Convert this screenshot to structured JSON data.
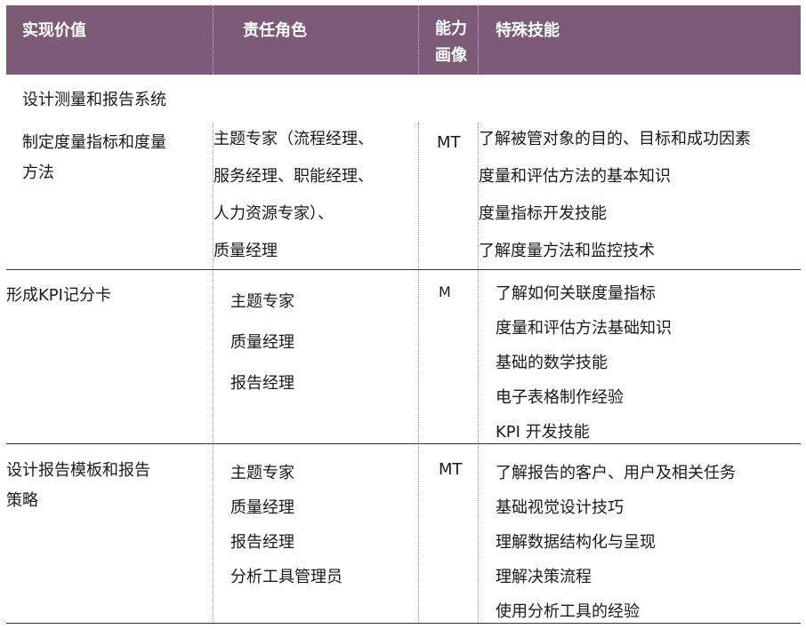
{
  "header": {
    "col1": "实现价值",
    "col2": "责任角色",
    "col3_line1": "能力",
    "col3_line2": "画像",
    "col4": "特殊技能"
  },
  "section_title": "设计测量和报告系统",
  "rows": [
    {
      "value_line1": "制定度量指标和度量",
      "value_line2": "方法",
      "roles": [
        "主题专家（流程经理、",
        "服务经理、职能经理、",
        "人力资源专家）、",
        "质量经理"
      ],
      "profile": "MT",
      "skills": [
        "了解被管对象的目的、目标和成功因素",
        "度量和评估方法的基本知识",
        "度量指标开发技能",
        "了解度量方法和监控技术"
      ]
    },
    {
      "value_line1": "形成KPI记分卡",
      "roles": [
        "主题专家",
        "质量经理",
        "报告经理"
      ],
      "profile": "M",
      "skills": [
        "了解如何关联度量指标",
        "度量和评估方法基础知识",
        "基础的数学技能",
        "电子表格制作经验",
        "KPI 开发技能"
      ]
    },
    {
      "value_line1": "设计报告模板和报告",
      "value_line2": "策略",
      "roles": [
        "主题专家",
        "质量经理",
        "报告经理",
        "分析工具管理员"
      ],
      "profile": "MT",
      "skills": [
        "了解报告的客户、用户及相关任务",
        "基础视觉设计技巧",
        "理解数据结构化与呈现",
        "理解决策流程",
        "使用分析工具的经验"
      ]
    }
  ]
}
